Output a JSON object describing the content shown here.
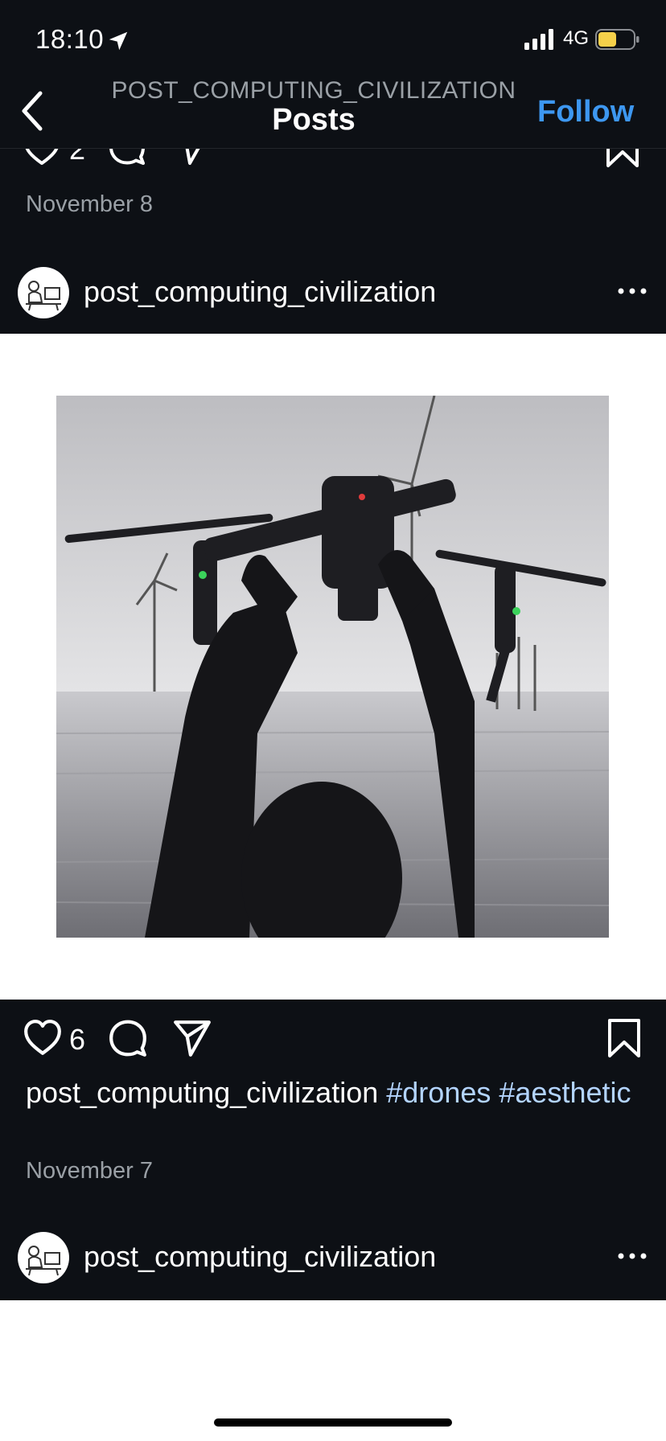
{
  "status_bar": {
    "time": "18:10",
    "network": "4G"
  },
  "header": {
    "subtitle": "POST_COMPUTING_CIVILIZATION",
    "title": "Posts",
    "follow_label": "Follow"
  },
  "previous_post": {
    "like_count": "2",
    "date": "November 8"
  },
  "post": {
    "username": "post_computing_civilization",
    "like_count": "6",
    "caption_username": "post_computing_civilization",
    "hashtags": [
      "#drones",
      "#aesthetic"
    ],
    "date": "November 7"
  },
  "next_post": {
    "username": "post_computing_civilization"
  },
  "colors": {
    "background": "#0d1015",
    "accent": "#3d97f0",
    "hashtag": "#b3d4ff",
    "muted": "#9aa0a6",
    "battery": "#f5d04a"
  }
}
